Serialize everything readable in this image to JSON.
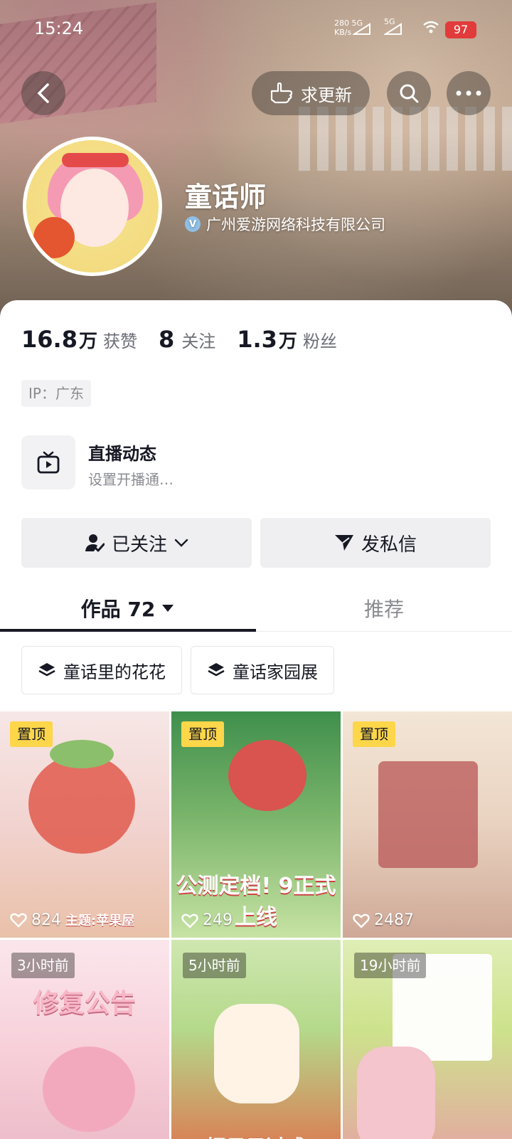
{
  "status_bar": {
    "time": "15:24",
    "net_speed": "280 5G KB/s",
    "network_label": "5G",
    "battery": "97"
  },
  "header": {
    "back_icon": "chevron-left-icon",
    "request_update_label": "求更新",
    "search_icon": "search-icon",
    "more_icon": "more-icon"
  },
  "profile": {
    "name": "童话师",
    "verified_org": "广州爱游网络科技有限公司"
  },
  "stats": [
    {
      "num": "16.8",
      "unit": "万",
      "label": "获赞"
    },
    {
      "num": "8",
      "unit": "",
      "label": "关注"
    },
    {
      "num": "1.3",
      "unit": "万",
      "label": "粉丝"
    }
  ],
  "ip_label": "IP：广东",
  "live": {
    "title": "直播动态",
    "subtitle": "设置开播通…"
  },
  "actions": {
    "followed_label": "已关注",
    "message_label": "发私信"
  },
  "tabs": {
    "works_label": "作品 72",
    "recommend_label": "推荐"
  },
  "collections": [
    {
      "label": "童话里的花花"
    },
    {
      "label": "童话家园展"
    }
  ],
  "videos": [
    {
      "badge": "置顶",
      "likes": "824",
      "caption": "主题:苹果屋"
    },
    {
      "badge": "置顶",
      "likes": "249",
      "caption": "公测定档! 9正式上线"
    },
    {
      "badge": "置顶",
      "likes": "2487",
      "caption": ""
    },
    {
      "badge": "3小时前",
      "likes": "",
      "caption": "修复公告"
    },
    {
      "badge": "5小时前",
      "likes": "",
      "caption": "把日子过成"
    },
    {
      "badge": "19小时前",
      "likes": "",
      "caption": ""
    }
  ],
  "colors": {
    "accent_yellow": "#fdd64a",
    "text_primary": "#161823",
    "text_secondary": "#8a8b91"
  }
}
